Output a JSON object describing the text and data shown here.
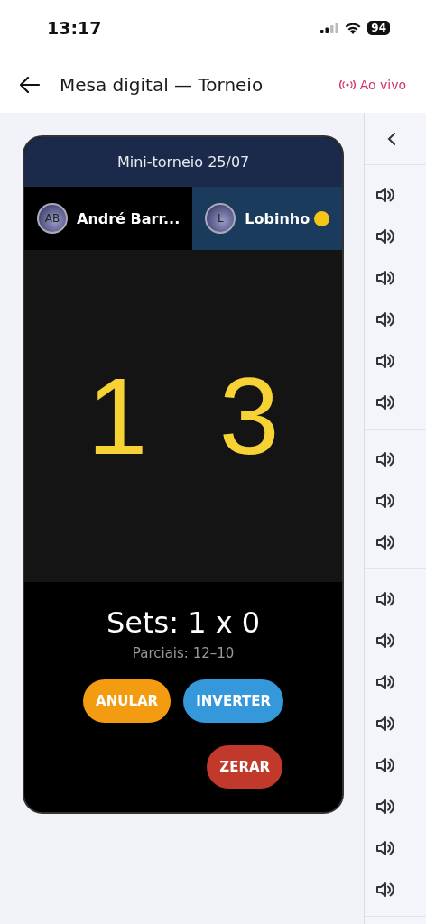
{
  "status_bar": {
    "time": "13:17",
    "battery": "94"
  },
  "nav": {
    "title": "Mesa digital — Torneio",
    "live_label": "Ao vivo"
  },
  "match": {
    "title": "Mini-torneio 25/07",
    "players": [
      {
        "initials": "AB",
        "name": "André Barr...",
        "selected": false,
        "serving": false
      },
      {
        "initials": "L",
        "name": "Lobinho",
        "selected": true,
        "serving": true
      }
    ],
    "scores": [
      "1",
      "3"
    ],
    "sets": "Sets: 1 x 0",
    "partials": "Parciais: 12–10",
    "buttons": [
      {
        "label": "ANULAR",
        "color": "#f39c12"
      },
      {
        "label": "INVERTER",
        "color": "#3498db"
      },
      {
        "label": "ZERAR",
        "color": "#c0392b"
      }
    ]
  }
}
